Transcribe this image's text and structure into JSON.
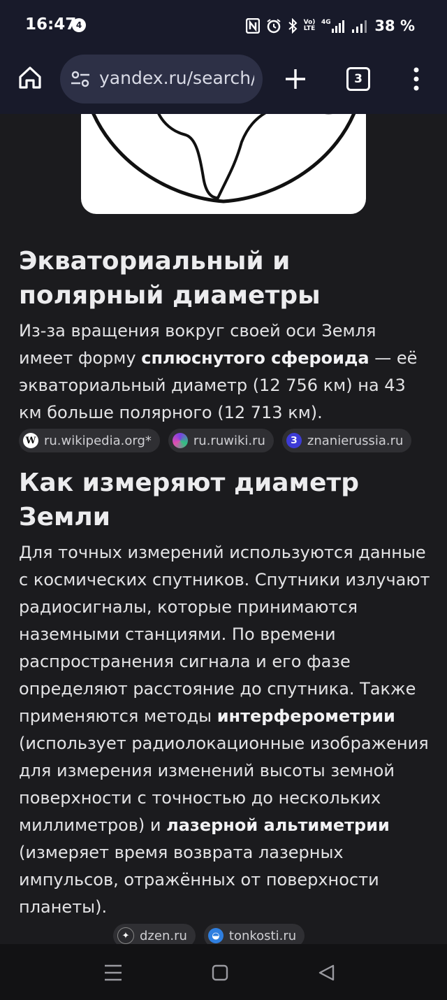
{
  "status_bar": {
    "time": "16:47",
    "notification_count": "4",
    "volte_label": "VoLTE",
    "network_label": "4G",
    "battery": "38 %"
  },
  "browser": {
    "url": "yandex.ru/search/",
    "tab_count": "3"
  },
  "section1": {
    "heading": "Экваториальный и полярный диаметры",
    "text_before": "Из-за вращения вокруг своей оси Земля имеет форму ",
    "bold": "сплюснутого сфероида",
    "text_after": " — её экваториальный диаметр (12 756 км) на 43 км больше полярного (12 713 км).",
    "sources": [
      {
        "label": "ru.wikipedia.org*",
        "icon": "wikipedia-icon"
      },
      {
        "label": "ru.ruwiki.ru",
        "icon": "ruwiki-icon"
      },
      {
        "label": "znanierussia.ru",
        "icon": "znanie-icon"
      }
    ]
  },
  "section2": {
    "heading": "Как измеряют диаметр Земли",
    "text1": "Для точных измерений используются данные с космических спутников. Спутники излучают радиосигналы, которые принимаются наземными станциями. По времени распространения сигнала и его фазе определяют расстояние до спутника. Также применяются методы ",
    "bold1": "интерферометрии",
    "text2": " (использует радиолокационные изображения для измерения изменений высоты земной поверхности с точностью до нескольких миллиметров) и ",
    "bold2": "лазерной альтиметрии",
    "text3": " (измеряет время возврата лазерных импульсов, отражённых от поверхности планеты).",
    "sources": [
      {
        "label": "dzen.ru",
        "icon": "dzen-icon"
      },
      {
        "label": "tonkosti.ru",
        "icon": "tonkosti-icon"
      }
    ]
  },
  "colors": {
    "background": "#1b1b1e",
    "toolbar": "#181a2a",
    "urlbar": "#2d3046",
    "chip": "#2f2f33"
  }
}
